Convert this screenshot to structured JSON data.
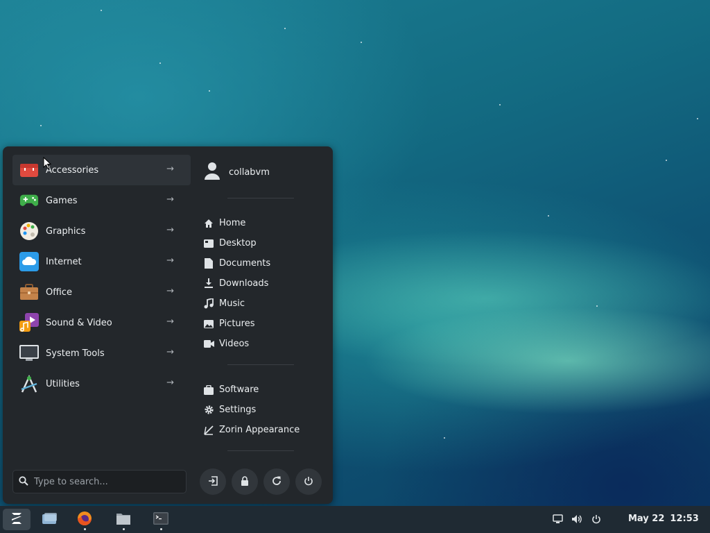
{
  "menu": {
    "categories": [
      {
        "label": "Accessories",
        "icon": "accessories-icon",
        "arrow": "→"
      },
      {
        "label": "Games",
        "icon": "games-icon",
        "arrow": "→"
      },
      {
        "label": "Graphics",
        "icon": "graphics-icon",
        "arrow": "→"
      },
      {
        "label": "Internet",
        "icon": "internet-icon",
        "arrow": "→"
      },
      {
        "label": "Office",
        "icon": "office-icon",
        "arrow": "→"
      },
      {
        "label": "Sound & Video",
        "icon": "sound-video-icon",
        "arrow": "→"
      },
      {
        "label": "System Tools",
        "icon": "system-tools-icon",
        "arrow": "→"
      },
      {
        "label": "Utilities",
        "icon": "utilities-icon",
        "arrow": "→"
      }
    ],
    "user": {
      "name": "collabvm",
      "icon": "user-avatar-icon"
    },
    "places": [
      {
        "label": "Home",
        "icon": "home-icon"
      },
      {
        "label": "Desktop",
        "icon": "desktop-icon"
      },
      {
        "label": "Documents",
        "icon": "documents-icon"
      },
      {
        "label": "Downloads",
        "icon": "downloads-icon"
      },
      {
        "label": "Music",
        "icon": "music-icon"
      },
      {
        "label": "Pictures",
        "icon": "pictures-icon"
      },
      {
        "label": "Videos",
        "icon": "videos-icon"
      }
    ],
    "apps": [
      {
        "label": "Software",
        "icon": "software-icon"
      },
      {
        "label": "Settings",
        "icon": "settings-icon"
      },
      {
        "label": "Zorin Appearance",
        "icon": "zorin-appearance-icon"
      }
    ],
    "search": {
      "placeholder": "Type to search..."
    },
    "power_buttons": [
      "log-out-icon",
      "lock-icon",
      "restart-icon",
      "power-icon"
    ]
  },
  "taskbar": {
    "launchers": [
      "zorin-menu-icon",
      "workspaces-icon",
      "firefox-icon",
      "files-icon",
      "terminal-icon"
    ],
    "tray": [
      "display-icon",
      "volume-icon",
      "power-icon"
    ],
    "date": "May 22",
    "time": "12:53"
  },
  "colors": {
    "menu_bg": "#23272b",
    "taskbar_bg": "#1f2a33",
    "accent": "#15a6f0"
  }
}
